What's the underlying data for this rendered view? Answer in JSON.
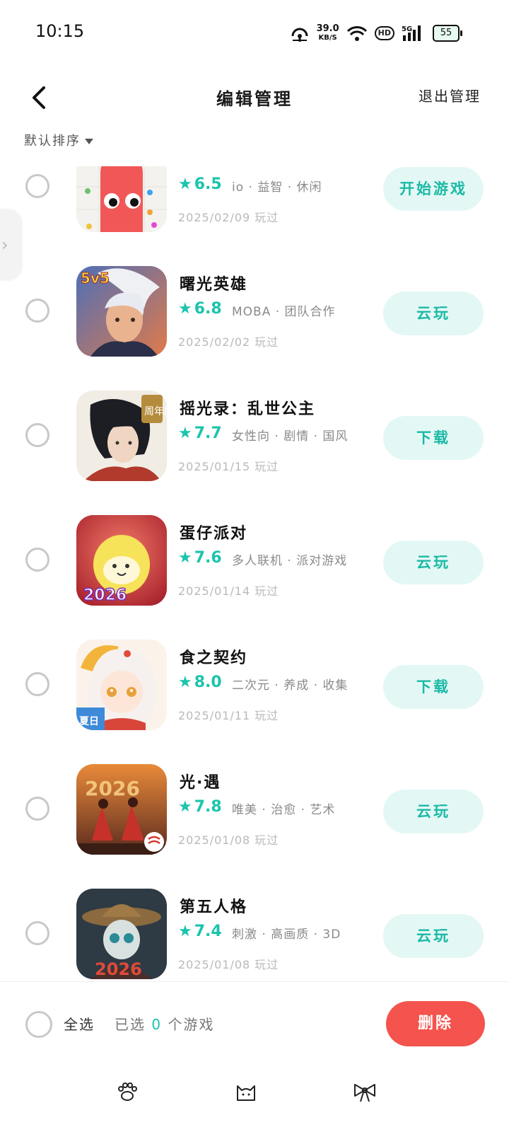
{
  "status_bar": {
    "time": "10:15",
    "net_speed": "39.0",
    "net_unit": "KB/S",
    "hd_label": "HD",
    "signal_label": "5G",
    "battery": "55"
  },
  "header": {
    "title": "编辑管理",
    "exit_label": "退出管理"
  },
  "sort": {
    "label": "默认排序"
  },
  "games": [
    {
      "name": "",
      "rating": "6.5",
      "tags": "io · 益智 · 休闲",
      "played": "2025/02/09 玩过",
      "action": "开始游戏",
      "icon": "red-blob-icon"
    },
    {
      "name": "曙光英雄",
      "rating": "6.8",
      "tags": "MOBA · 团队合作",
      "played": "2025/02/02 玩过",
      "action": "云玩",
      "icon": "hero-icon"
    },
    {
      "name": "摇光录：乱世公主",
      "rating": "7.7",
      "tags": "女性向 · 剧情 · 国风",
      "played": "2025/01/15 玩过",
      "action": "下载",
      "icon": "ancient-hero-icon"
    },
    {
      "name": "蛋仔派对",
      "rating": "7.6",
      "tags": "多人联机 · 派对游戏",
      "played": "2025/01/14 玩过",
      "action": "云玩",
      "icon": "eggy-icon"
    },
    {
      "name": "食之契约",
      "rating": "8.0",
      "tags": "二次元 · 养成 · 收集",
      "played": "2025/01/11 玩过",
      "action": "下载",
      "icon": "anime-girl-icon"
    },
    {
      "name": "光·遇",
      "rating": "7.8",
      "tags": "唯美 · 治愈 · 艺术",
      "played": "2025/01/08 玩过",
      "action": "云玩",
      "icon": "sky-children-icon"
    },
    {
      "name": "第五人格",
      "rating": "7.4",
      "tags": "刺激 · 高画质 · 3D",
      "played": "2025/01/08 玩过",
      "action": "云玩",
      "icon": "identity-doll-icon"
    }
  ],
  "icon_texts": {
    "hero_badge": "5v5",
    "anniv_badge": "周年庆",
    "year": "2026",
    "summer_badge": "夏日"
  },
  "bottom": {
    "select_all": "全选",
    "selected_prefix": "已选",
    "selected_count": "0",
    "selected_suffix": "个游戏",
    "delete_label": "删除"
  },
  "colors": {
    "accent": "#1bc4ad",
    "button_bg": "#e3f8f5",
    "delete": "#f5534d"
  },
  "nav_icons": [
    "paw-icon",
    "cat-icon",
    "bow-icon"
  ]
}
